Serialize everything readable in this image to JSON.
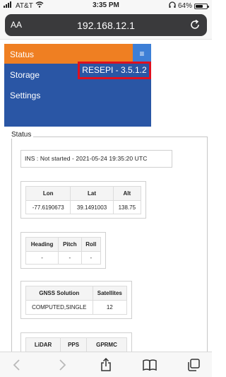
{
  "status_bar": {
    "carrier": "AT&T",
    "time": "3:35 PM",
    "battery": "64%",
    "battery_fraction": 0.64
  },
  "browser": {
    "aa_label": "AA",
    "url": "192.168.12.1"
  },
  "menu": {
    "items": [
      "Status",
      "Storage",
      "Settings"
    ],
    "active": "Status",
    "toggle_icon": "≡",
    "version": "RESEPI - 3.5.1.2"
  },
  "status": {
    "legend": "Status",
    "ins": "INS : Not started - 2021-05-24 19:35:20 UTC",
    "position": {
      "headers": [
        "Lon",
        "Lat",
        "Alt"
      ],
      "values": [
        "-77.6190673",
        "39.1491003",
        "138.75"
      ]
    },
    "attitude": {
      "headers": [
        "Heading",
        "Pitch",
        "Roll"
      ],
      "values": [
        "-",
        "-",
        "-"
      ]
    },
    "gnss": {
      "headers": [
        "GNSS Solution",
        "Satellites"
      ],
      "values": [
        "COMPUTED,SINGLE",
        "12"
      ]
    },
    "lidar": {
      "headers": [
        "LiDAR",
        "PPS",
        "GPRMC"
      ]
    }
  },
  "icons": {
    "wifi": "wifi-icon",
    "headphones": "headphones-icon",
    "reload": "reload-icon",
    "back": "back-icon",
    "forward": "forward-icon",
    "share": "share-icon",
    "bookmarks": "bookmarks-icon",
    "tabs": "tabs-icon"
  },
  "colors": {
    "menu_bg": "#2a56a5",
    "menu_active": "#ef7f22",
    "toggle_bg": "#3d7fd6",
    "highlight": "#e0101e"
  }
}
